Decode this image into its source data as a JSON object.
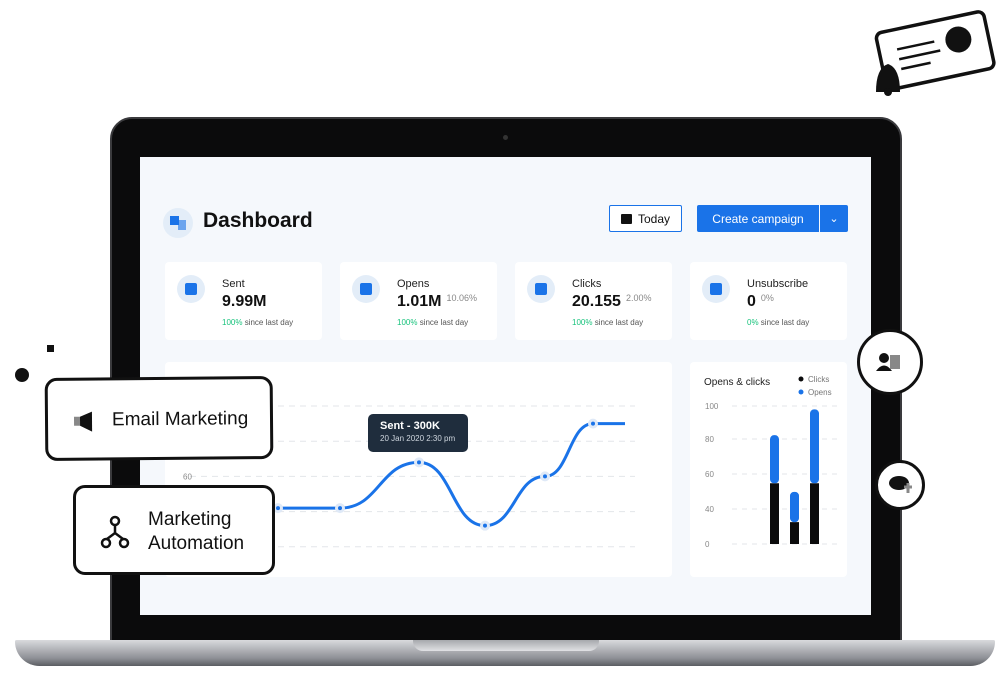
{
  "dashboard": {
    "title": "Dashboard",
    "logo_icon": "dashboard-logo-icon"
  },
  "toolbar": {
    "today_label": "Today",
    "create_label": "Create campaign",
    "calendar_icon": "calendar-icon",
    "dropdown_icon": "chevron-down-icon"
  },
  "colors": {
    "accent": "#1a73e8",
    "positive": "#19c37d",
    "dark": "#0b0b0c",
    "tooltip": "#1f2d3d"
  },
  "stats": [
    {
      "label": "Sent",
      "value": "9.99M",
      "pct": "",
      "change": "100%",
      "since": "since last day"
    },
    {
      "label": "Opens",
      "value": "1.01M",
      "pct": "10.06%",
      "change": "100%",
      "since": "since last day"
    },
    {
      "label": "Clicks",
      "value": "20.155",
      "pct": "2.00%",
      "change": "100%",
      "since": "since last day"
    },
    {
      "label": "Unsubscribe",
      "value": "0",
      "pct": "0%",
      "change": "0%",
      "since": "since last day"
    }
  ],
  "chart_data": [
    {
      "type": "line",
      "y_tick_labels": [
        "60"
      ],
      "x": [
        1,
        2,
        3,
        4,
        5,
        6,
        7
      ],
      "values": [
        42,
        42,
        68,
        32,
        60,
        90,
        90
      ],
      "tooltip": {
        "title": "Sent - 300K",
        "subtitle": "20 Jan 2020 2:30 pm"
      },
      "grid": true
    },
    {
      "type": "bar",
      "stacked": true,
      "title": "Opens & clicks",
      "y_tick_labels": [
        "100",
        "80",
        "60",
        "40",
        "0"
      ],
      "legend": "top-right",
      "series": [
        {
          "name": "Clicks",
          "color": "#0b0b0c",
          "values": [
            55,
            25,
            55
          ]
        },
        {
          "name": "Opens",
          "color": "#1a73e8",
          "values": [
            28,
            25,
            43
          ]
        }
      ]
    }
  ],
  "overlays": {
    "email": "Email Marketing",
    "automation_line1": "Marketing",
    "automation_line2": "Automation"
  }
}
